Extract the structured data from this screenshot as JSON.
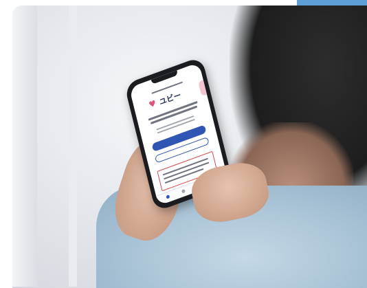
{
  "photo": {
    "subject": "person-holding-smartphone",
    "accent_color": "#5b9fd6"
  },
  "phone_screen": {
    "logo_text": "ユビー",
    "heart_icon": "heart-icon",
    "primary_button_color": "#2f56b3",
    "notice_border_color": "#d34a4a"
  }
}
